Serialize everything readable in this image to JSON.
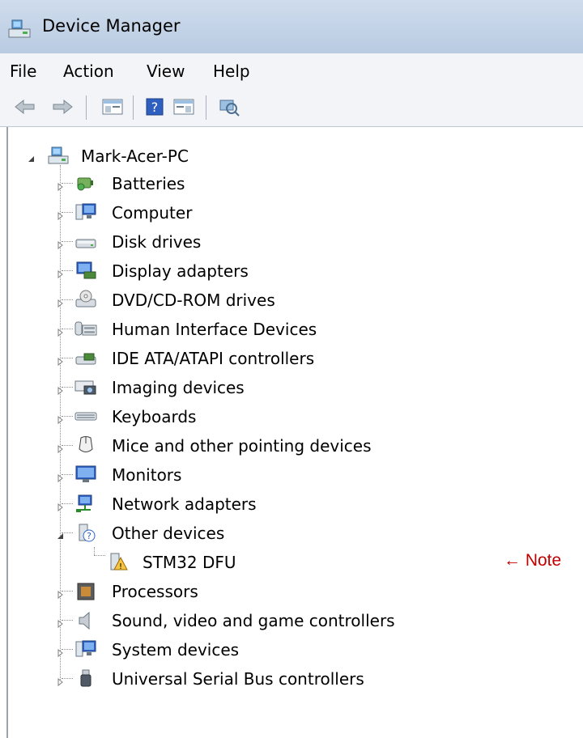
{
  "window": {
    "title": "Device Manager"
  },
  "menu": [
    "File",
    "Action",
    "View",
    "Help"
  ],
  "tree": {
    "root": "Mark-Acer-PC",
    "categories": [
      {
        "label": "Batteries",
        "icon": "battery-icon"
      },
      {
        "label": "Computer",
        "icon": "computer-icon"
      },
      {
        "label": "Disk drives",
        "icon": "disk-drive-icon"
      },
      {
        "label": "Display adapters",
        "icon": "display-adapter-icon"
      },
      {
        "label": "DVD/CD-ROM drives",
        "icon": "dvd-drive-icon"
      },
      {
        "label": "Human Interface Devices",
        "icon": "hid-icon"
      },
      {
        "label": "IDE ATA/ATAPI controllers",
        "icon": "ide-controller-icon"
      },
      {
        "label": "Imaging devices",
        "icon": "imaging-device-icon"
      },
      {
        "label": "Keyboards",
        "icon": "keyboard-icon"
      },
      {
        "label": "Mice and other pointing devices",
        "icon": "mouse-icon"
      },
      {
        "label": "Monitors",
        "icon": "monitor-icon"
      },
      {
        "label": "Network adapters",
        "icon": "network-adapter-icon"
      },
      {
        "label": "Other devices",
        "icon": "unknown-device-icon",
        "expanded": true
      },
      {
        "label": "Processors",
        "icon": "processor-icon"
      },
      {
        "label": "Sound, video and game controllers",
        "icon": "speaker-icon"
      },
      {
        "label": "System devices",
        "icon": "system-device-icon"
      },
      {
        "label": "Universal Serial Bus controllers",
        "icon": "usb-icon"
      }
    ],
    "other_device_child": {
      "label": "STM32 DFU",
      "icon": "warning-device-icon"
    }
  },
  "annotation": {
    "text": "← Note"
  }
}
